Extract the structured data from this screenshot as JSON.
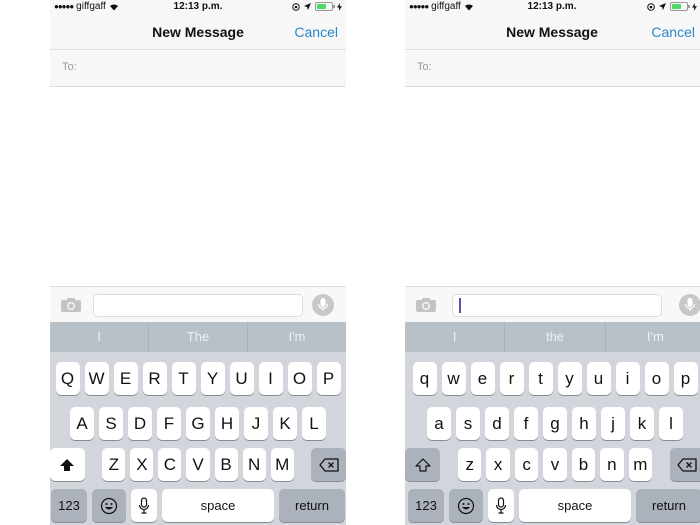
{
  "screens": [
    {
      "id": "left",
      "status_bar": {
        "carrier": "giffgaff",
        "signal_dots": "●●●●●",
        "time": "12:13 p.m."
      },
      "nav": {
        "title": "New Message",
        "cancel_label": "Cancel"
      },
      "to_label": "To:",
      "message_input": {
        "value": "",
        "cursor_visible": false
      },
      "suggestions": [
        "I",
        "The",
        "I'm"
      ],
      "keyboard": {
        "row1": [
          "Q",
          "W",
          "E",
          "R",
          "T",
          "Y",
          "U",
          "I",
          "O",
          "P"
        ],
        "row2": [
          "A",
          "S",
          "D",
          "F",
          "G",
          "H",
          "J",
          "K",
          "L"
        ],
        "row3": [
          "Z",
          "X",
          "C",
          "V",
          "B",
          "N",
          "M"
        ],
        "shift_state": "active",
        "numbers_label": "123",
        "space_label": "space",
        "return_label": "return"
      }
    },
    {
      "id": "right",
      "status_bar": {
        "carrier": "giffgaff",
        "signal_dots": "●●●●●",
        "time": "12:13 p.m."
      },
      "nav": {
        "title": "New Message",
        "cancel_label": "Cancel"
      },
      "to_label": "To:",
      "message_input": {
        "value": "",
        "cursor_visible": true
      },
      "suggestions": [
        "I",
        "the",
        "I'm"
      ],
      "keyboard": {
        "row1": [
          "q",
          "w",
          "e",
          "r",
          "t",
          "y",
          "u",
          "i",
          "o",
          "p"
        ],
        "row2": [
          "a",
          "s",
          "d",
          "f",
          "g",
          "h",
          "j",
          "k",
          "l"
        ],
        "row3": [
          "z",
          "x",
          "c",
          "v",
          "b",
          "n",
          "m"
        ],
        "shift_state": "inactive",
        "numbers_label": "123",
        "space_label": "space",
        "return_label": "return"
      }
    }
  ],
  "colors": {
    "accent": "#2a87c9",
    "battery": "#4cd964",
    "caret": "#5a4fb3"
  }
}
